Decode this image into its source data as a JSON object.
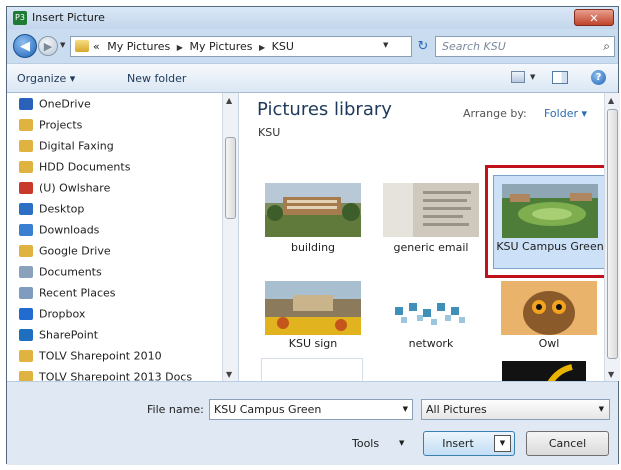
{
  "window": {
    "title": "Insert Picture",
    "app_icon": "P3",
    "close_label": "✕"
  },
  "nav": {
    "back_icon": "◀",
    "forward_icon": "▶",
    "breadcrumbs": [
      "«",
      "My Pictures",
      "My Pictures",
      "KSU"
    ],
    "refresh_icon": "↻",
    "search_placeholder": "Search KSU",
    "search_icon": "⌕"
  },
  "toolbar": {
    "organize": "Organize ▾",
    "new_folder": "New folder",
    "help": "?"
  },
  "sidebar": {
    "items": [
      {
        "label": "OneDrive",
        "color": "#2a62ba"
      },
      {
        "label": "Projects",
        "color": "#e0b240"
      },
      {
        "label": "Digital Faxing",
        "color": "#e0b240"
      },
      {
        "label": "HDD Documents",
        "color": "#e0b240"
      },
      {
        "label": "(U) Owlshare",
        "color": "#c8392b"
      },
      {
        "label": "Desktop",
        "color": "#2d6fc2"
      },
      {
        "label": "Downloads",
        "color": "#3a7fd0"
      },
      {
        "label": "Google Drive",
        "color": "#e0b240"
      },
      {
        "label": "Documents",
        "color": "#8aa2be"
      },
      {
        "label": "Recent Places",
        "color": "#7f9bc0"
      },
      {
        "label": "Dropbox",
        "color": "#1f6bd0"
      },
      {
        "label": "SharePoint",
        "color": "#1e6fc0"
      },
      {
        "label": "TOLV Sharepoint 2010",
        "color": "#e0b240"
      },
      {
        "label": "TOLV Sharepoint 2013 Docs",
        "color": "#e0b240"
      }
    ]
  },
  "library": {
    "title": "Pictures library",
    "subtitle": "KSU",
    "arrange_label": "Arrange by:",
    "arrange_value": "Folder ▾"
  },
  "thumbnails": [
    {
      "label": "building"
    },
    {
      "label": "generic email"
    },
    {
      "label": "KSU Campus Green"
    },
    {
      "label": "KSU sign"
    },
    {
      "label": "network"
    },
    {
      "label": "Owl"
    }
  ],
  "footer": {
    "file_name_label": "File name:",
    "file_name_value": "KSU Campus Green",
    "filter_value": "All Pictures",
    "tools_label": "Tools",
    "insert_label": "Insert",
    "cancel_label": "Cancel"
  },
  "colors": {
    "selection_highlight": "#c1121c",
    "selected_tile": "#cce0f7",
    "title_blue": "#1e395b"
  }
}
